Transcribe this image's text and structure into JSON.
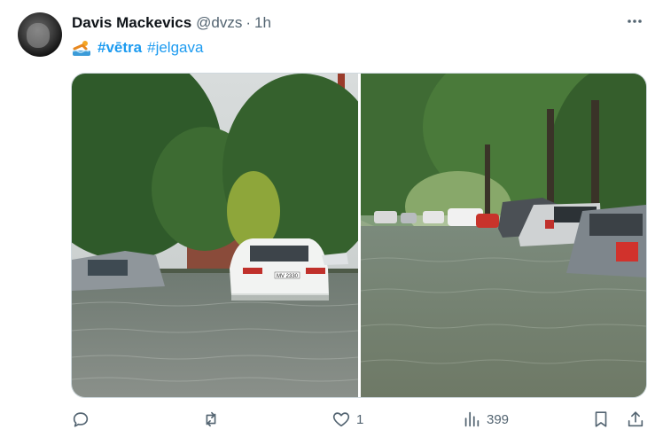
{
  "author": {
    "name": "Davis Mackevics",
    "handle": "@dvzs",
    "separator": "·",
    "time": "1h"
  },
  "tweet": {
    "emoji_icon": "swimmer-icon",
    "hashtags": [
      "#vētra",
      "#jelgava"
    ]
  },
  "media": {
    "left_image": {
      "plate_text": "MV 2330"
    }
  },
  "actions": {
    "reply": {
      "icon": "reply-icon",
      "count": ""
    },
    "retweet": {
      "icon": "retweet-icon",
      "count": ""
    },
    "like": {
      "icon": "heart-icon",
      "count": "1"
    },
    "views": {
      "icon": "views-icon",
      "count": "399"
    },
    "bookmark": {
      "icon": "bookmark-icon"
    },
    "share": {
      "icon": "share-icon"
    }
  },
  "colors": {
    "accent": "#1d9bf0",
    "text": "#0f1419",
    "secondary": "#536471",
    "border": "#cfd9de"
  }
}
